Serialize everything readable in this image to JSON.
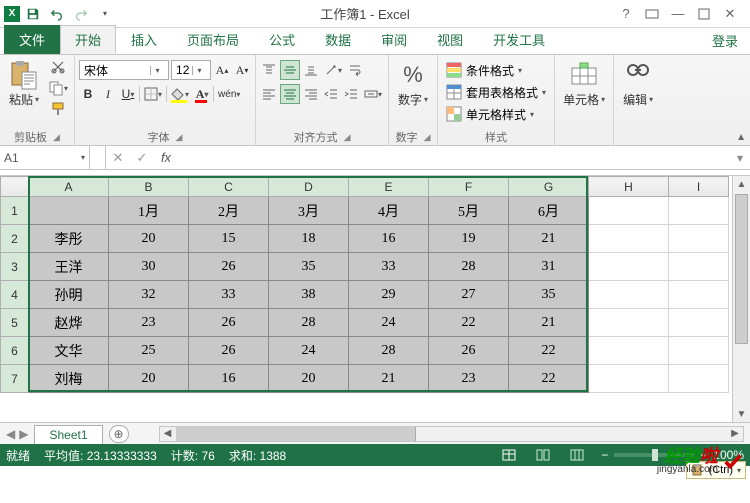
{
  "title": "工作簿1 - Excel",
  "login": "登录",
  "tabs": {
    "file": "文件",
    "home": "开始",
    "insert": "插入",
    "layout": "页面布局",
    "formulas": "公式",
    "data": "数据",
    "review": "审阅",
    "view": "视图",
    "developer": "开发工具"
  },
  "ribbon": {
    "clipboard": {
      "paste": "粘贴",
      "group": "剪贴板"
    },
    "font": {
      "name": "宋体",
      "size": "12",
      "bold": "B",
      "italic": "I",
      "underline": "U",
      "group": "字体"
    },
    "alignment": {
      "group": "对齐方式"
    },
    "number": {
      "label": "数字",
      "group": "数字"
    },
    "styles": {
      "cond": "条件格式",
      "table": "套用表格格式",
      "cell": "单元格样式",
      "group": "样式"
    },
    "cells": {
      "label": "单元格"
    },
    "editing": {
      "label": "编辑"
    }
  },
  "namebox": "A1",
  "fx": "fx",
  "columns": [
    "A",
    "B",
    "C",
    "D",
    "E",
    "F",
    "G",
    "H",
    "I"
  ],
  "rows": [
    "1",
    "2",
    "3",
    "4",
    "5",
    "6",
    "7"
  ],
  "chart_data": {
    "type": "table",
    "title": "",
    "categories": [
      "1月",
      "2月",
      "3月",
      "4月",
      "5月",
      "6月"
    ],
    "series": [
      {
        "name": "李彤",
        "values": [
          20,
          15,
          18,
          16,
          19,
          21
        ]
      },
      {
        "name": "王洋",
        "values": [
          30,
          26,
          35,
          33,
          28,
          31
        ]
      },
      {
        "name": "孙明",
        "values": [
          32,
          33,
          38,
          29,
          27,
          35
        ]
      },
      {
        "name": "赵烨",
        "values": [
          23,
          26,
          28,
          24,
          22,
          21
        ]
      },
      {
        "name": "文华",
        "values": [
          25,
          26,
          24,
          28,
          26,
          22
        ]
      },
      {
        "name": "刘梅",
        "values": [
          20,
          16,
          20,
          21,
          23,
          22
        ]
      }
    ]
  },
  "sheet_tab": "Sheet1",
  "paste_options": "(Ctrl)",
  "status": {
    "ready": "就绪",
    "avg_label": "平均值:",
    "avg": "23.13333333",
    "count_label": "计数:",
    "count": "76",
    "sum_label": "求和:",
    "sum": "1388",
    "zoom": "100%"
  },
  "watermark": {
    "t1": "经验",
    "t2": "啦",
    "sub": "jingyanla.com"
  }
}
